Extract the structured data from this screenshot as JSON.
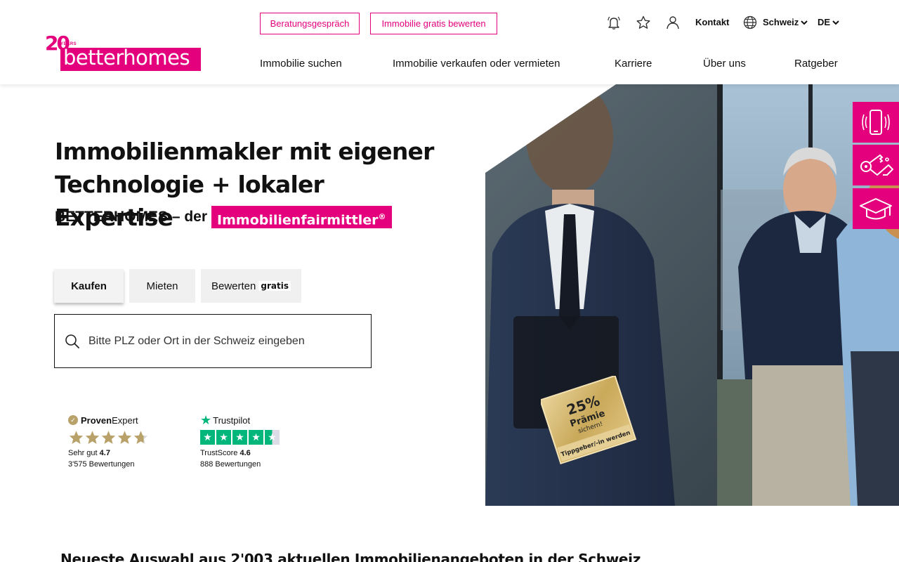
{
  "brand": {
    "logo_years": "20",
    "logo_years_label": "YEARS",
    "logo_name": "betterhomes",
    "accent_color": "#e4007c"
  },
  "header": {
    "cta_buttons": [
      "Beratungsgespräch",
      "Immobilie gratis bewerten"
    ],
    "utility": {
      "icons": [
        "bell-icon",
        "star-icon",
        "user-icon",
        "globe-icon"
      ],
      "contact": "Kontakt",
      "country": "Schweiz",
      "language": "DE"
    },
    "nav": [
      "Immobilie suchen",
      "Immobilie verkaufen oder vermieten",
      "Karriere",
      "Über uns",
      "Ratgeber"
    ]
  },
  "hero": {
    "title_line1": "Immobilienmakler mit eigener",
    "title_line2": "Technologie + lokaler Expertise",
    "subtitle_prefix": "BETTERHOMES – der",
    "subtitle_badge": "Immobilienfairmittler",
    "subtitle_badge_mark": "®",
    "tabs": [
      "Kaufen",
      "Mieten",
      "Bewerten"
    ],
    "active_tab": "Kaufen",
    "tab_badge": "gratis",
    "search_placeholder": "Bitte PLZ oder Ort in der Schweiz eingeben"
  },
  "ratings": {
    "proven_expert": {
      "logo_part1": "Proven",
      "logo_part2": "Expert",
      "label": "Sehr gut",
      "score": "4.7",
      "reviews": "3'575 Bewertungen",
      "stars": 4.7
    },
    "trustpilot": {
      "logo": "Trustpilot",
      "label": "TrustScore",
      "score": "4.6",
      "reviews": "888 Bewertungen",
      "stars": 4.5
    }
  },
  "promo": {
    "percent": "25%",
    "line1": "Prämie",
    "line2": "sichern!",
    "footer": "Tippgeber/-in werden"
  },
  "side_actions": [
    "phone-icon",
    "keys-icon",
    "graduation-cap-icon"
  ],
  "section": {
    "heading": "Neueste Auswahl aus 2'003 aktuellen Immobilienangeboten in der Schweiz"
  }
}
